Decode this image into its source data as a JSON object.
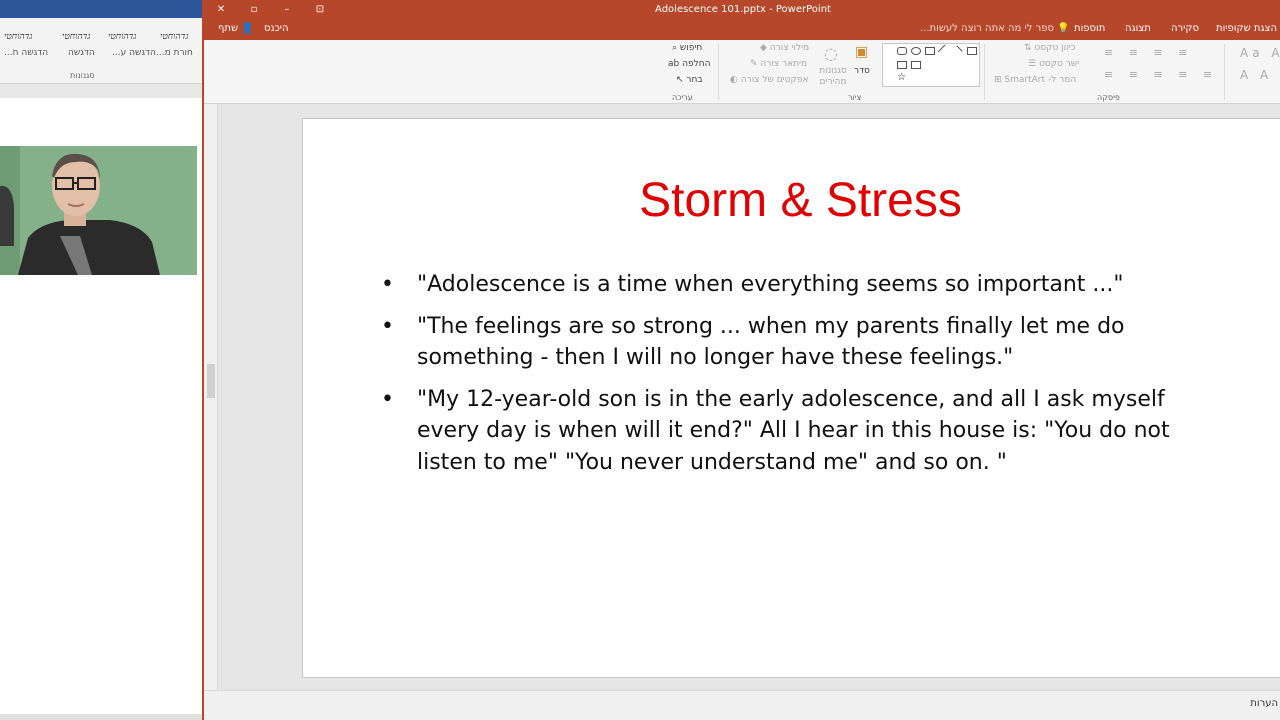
{
  "word": {
    "styles_row1": [
      "הדגשה ח...",
      "הדגשה",
      "הדגשה ע...",
      "הדגשה",
      "חורת מ..."
    ],
    "styles_row0": [
      "גדהוחטי",
      "גדהוחטי",
      "גדהוחטי",
      "גדהוחטי"
    ],
    "group_label": "סגנונות"
  },
  "ppt": {
    "window_title": "Adolescence 101.pptx - PowerPoint",
    "tabs": [
      "הצגת שקופיות",
      "סקירה",
      "תצוגה",
      "תוספות"
    ],
    "tell_me": "ספר לי מה אתה רוצה לעשות...",
    "sign_in": "היכנס",
    "share": "שתף",
    "ribbon": {
      "find": "חיפוש",
      "replace": "החלפה",
      "select": "בחר",
      "editing_group": "עריכה",
      "shape_fill": "מילוי צורה",
      "shape_outline": "מיתאר צורה",
      "shape_effects": "אפקטים של צורה",
      "quick_styles": "סגנונות מהירים",
      "arrange": "סדר",
      "drawing_group": "ציור",
      "text_direction": "כיוון טקסט",
      "align_text": "ישר טקסט",
      "convert_smartart": "המר ל- SmartArt",
      "paragraph_group": "פיסקה"
    },
    "status_notes": "הערות"
  },
  "slide": {
    "title": "Storm & Stress",
    "bullets": [
      "\"Adolescence is a time when everything seems so important ...\"",
      "\"The feelings are so strong ... when my parents finally let me do something - then I will no longer have these feelings.\"",
      "\"My 12-year-old son is in the early adolescence, and all I ask myself every day is when will it end?\" All I hear in this house is: \"You do not listen to me\" \"You never understand me\" and so on. \""
    ]
  },
  "colors": {
    "ppt_accent": "#b7472a",
    "word_accent": "#2b579a",
    "title_red": "#e00000"
  }
}
